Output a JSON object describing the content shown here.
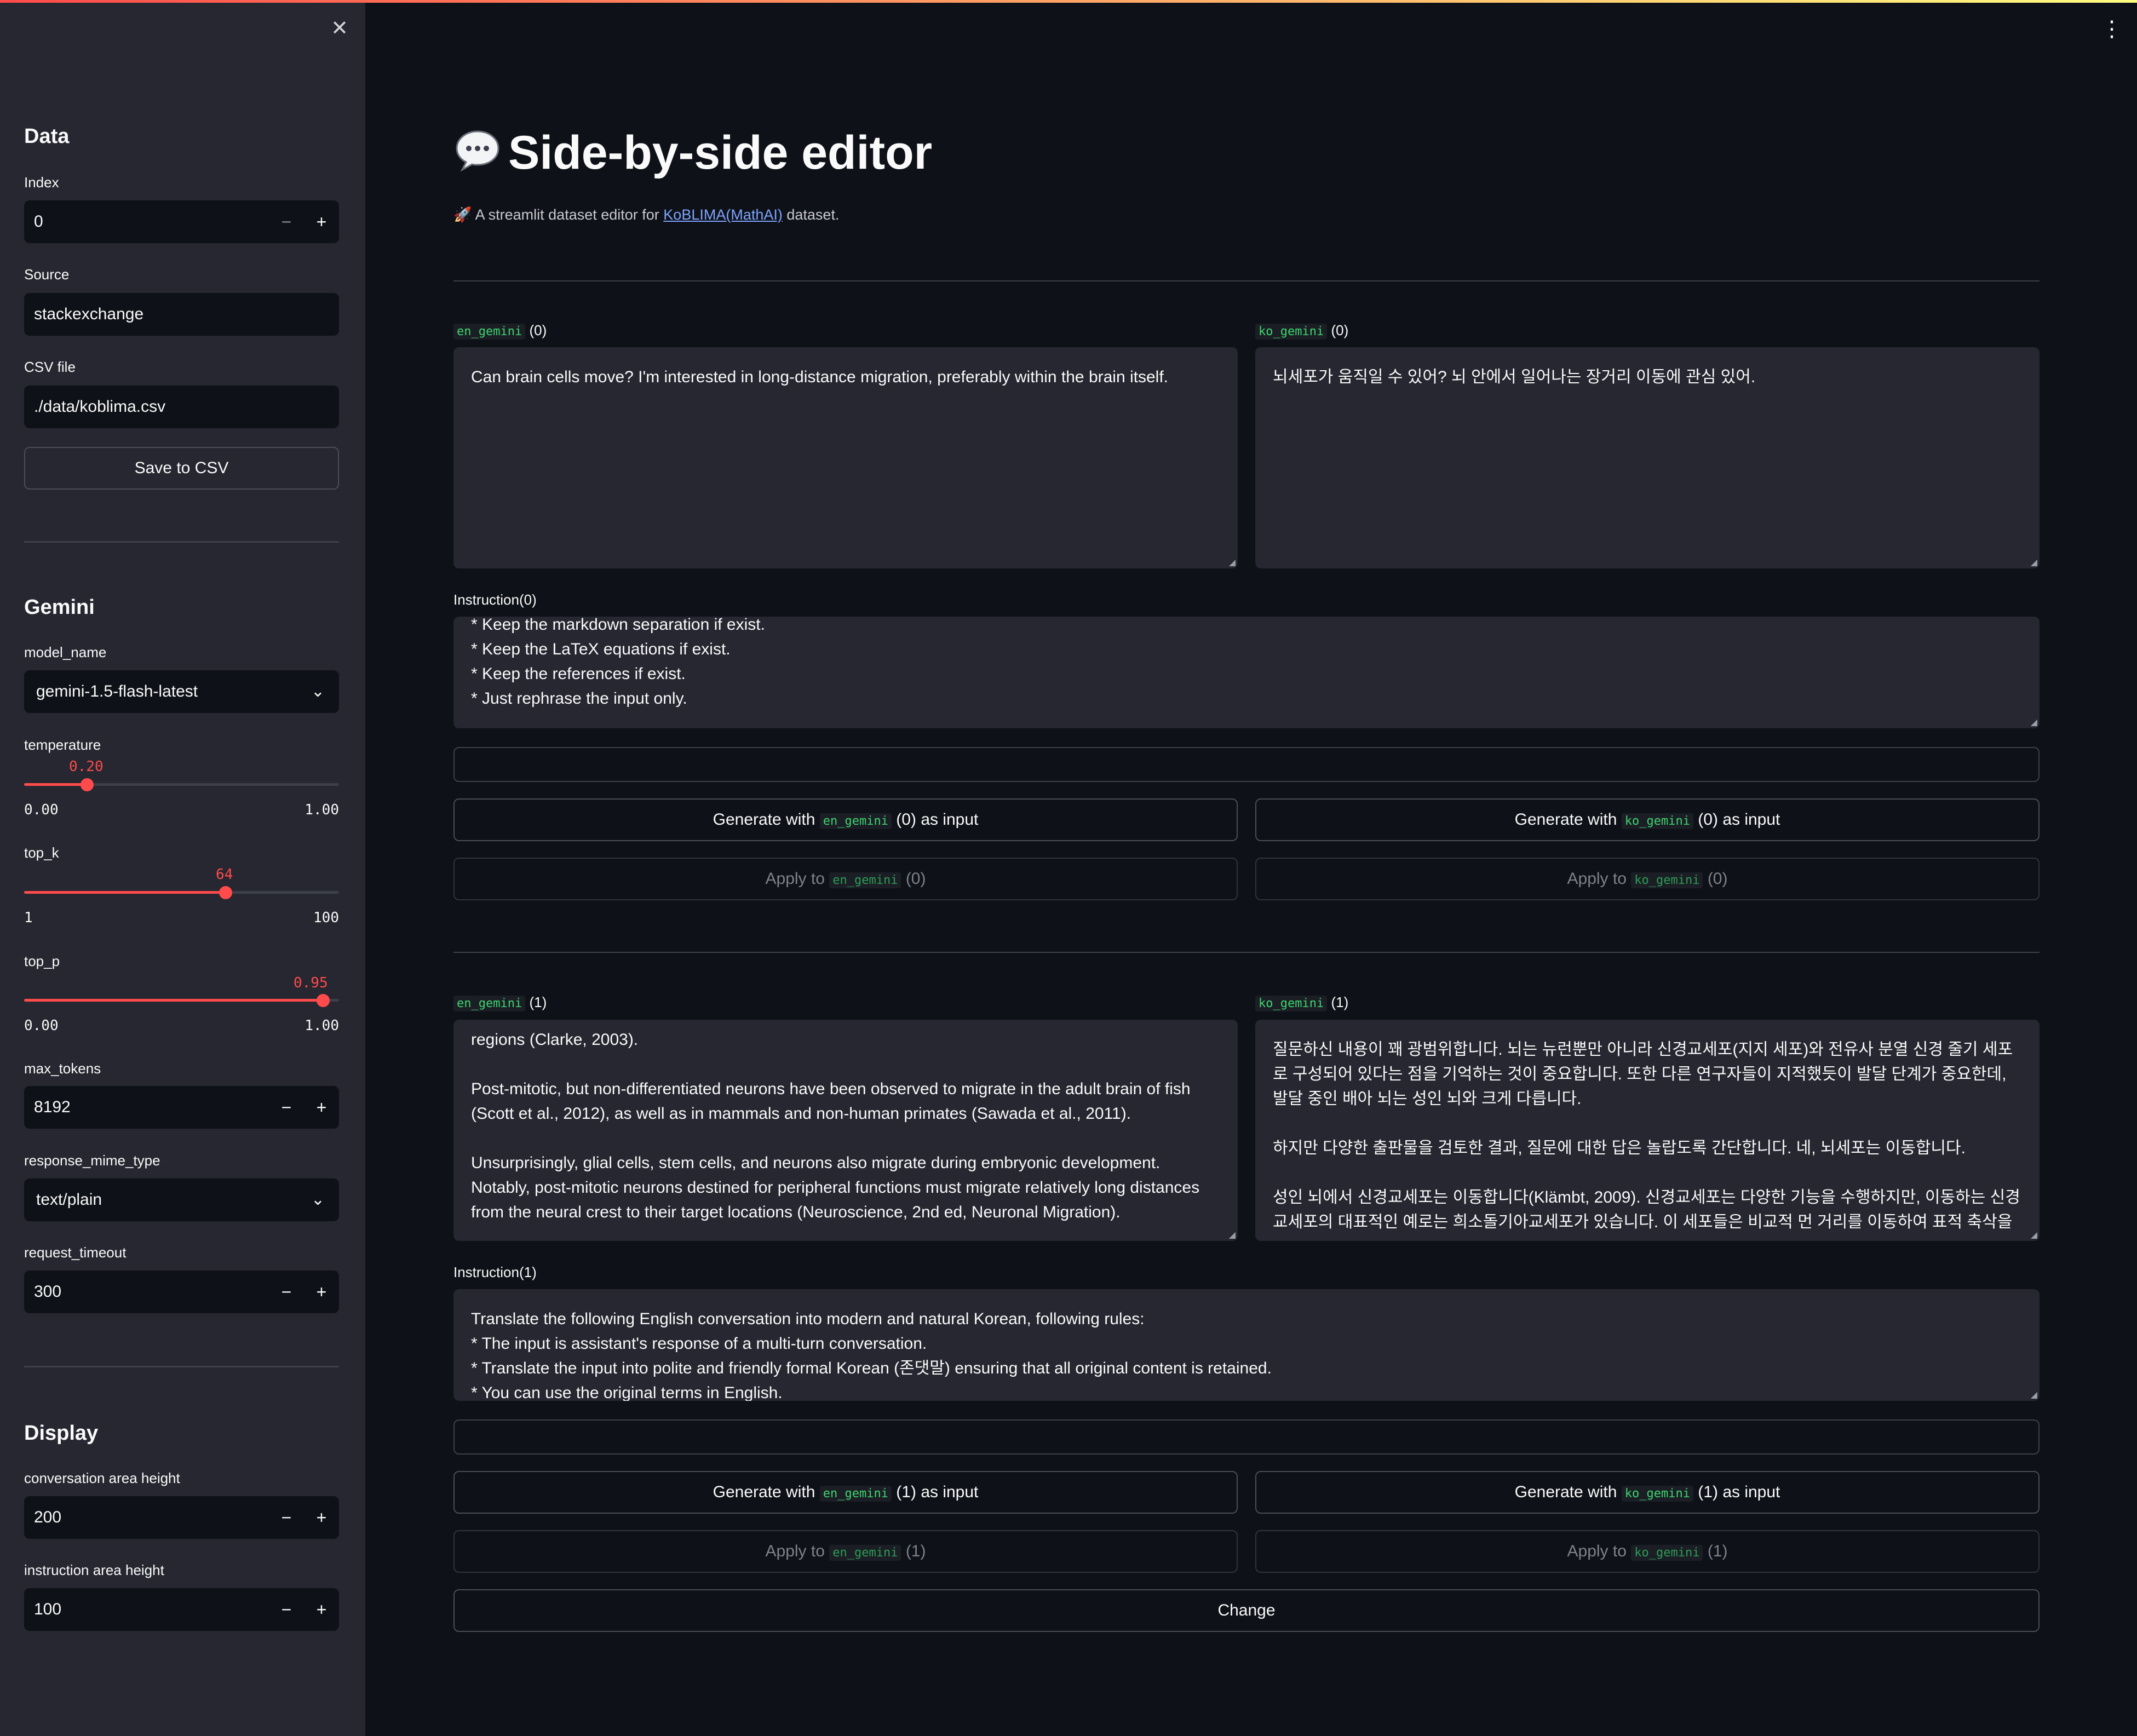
{
  "colors": {
    "accent": "#ff4b4b",
    "background": "#0e1117",
    "sidebar": "#262730",
    "link": "#7da4ff",
    "code": "#3dd56d"
  },
  "sidebar": {
    "close_icon": "close-icon",
    "data": {
      "header": "Data",
      "index_label": "Index",
      "index_value": "0",
      "source_label": "Source",
      "source_value": "stackexchange",
      "csv_label": "CSV file",
      "csv_value": "./data/koblima.csv",
      "save_label": "Save to CSV"
    },
    "gemini": {
      "header": "Gemini",
      "model_name_label": "model_name",
      "model_name_value": "gemini-1.5-flash-latest",
      "temperature": {
        "label": "temperature",
        "value": "0.20",
        "min": "0.00",
        "max": "1.00",
        "fraction": 0.2
      },
      "top_k": {
        "label": "top_k",
        "value": "64",
        "min": "1",
        "max": "100",
        "fraction": 0.64
      },
      "top_p": {
        "label": "top_p",
        "value": "0.95",
        "min": "0.00",
        "max": "1.00",
        "fraction": 0.95
      },
      "max_tokens_label": "max_tokens",
      "max_tokens_value": "8192",
      "mime_label": "response_mime_type",
      "mime_value": "text/plain",
      "timeout_label": "request_timeout",
      "timeout_value": "300"
    },
    "display": {
      "header": "Display",
      "conv_height_label": "conversation area height",
      "conv_height_value": "200",
      "instr_height_label": "instruction area height",
      "instr_height_value": "100"
    },
    "stepper": {
      "minus": "−",
      "plus": "+"
    }
  },
  "main": {
    "title": "Side-by-side editor",
    "subtitle_prefix": "🚀 A streamlit dataset editor for ",
    "subtitle_link": "KoBLIMA(MathAI)",
    "subtitle_suffix": " dataset.",
    "tag_en": "en_gemini",
    "tag_ko": "ko_gemini",
    "generate_prefix": "Generate with",
    "apply_prefix": "Apply to",
    "as_input": "as input",
    "change_label": "Change",
    "turns": [
      {
        "index_label": "(0)",
        "en_text": "Can brain cells move? I'm interested in long-distance migration, preferably within the brain itself.",
        "ko_text": "뇌세포가 움직일 수 있어? 뇌 안에서 일어나는 장거리 이동에 관심 있어.",
        "instruction_label": "Instruction(0)",
        "instruction_text": "* Keep the markdown separation if exist.\n* Keep the LaTeX equations if exist.\n* Keep the references if exist.\n* Just rephrase the input only."
      },
      {
        "index_label": "(1)",
        "en_text": "regions (Clarke, 2003).\n\nPost-mitotic, but non-differentiated neurons have been observed to migrate in the adult brain of fish (Scott et al., 2012), as well as in mammals and non-human primates (Sawada et al., 2011).\n\nUnsurprisingly, glial cells, stem cells, and neurons also migrate during embryonic development. Notably, post-mitotic neurons destined for peripheral functions must migrate relatively long distances from the neural crest to their target locations (Neuroscience, 2nd ed, Neuronal Migration).",
        "ko_text": "질문하신 내용이 꽤 광범위합니다. 뇌는 뉴런뿐만 아니라 신경교세포(지지 세포)와 전유사 분열 신경 줄기 세포로 구성되어 있다는 점을 기억하는 것이 중요합니다. 또한 다른 연구자들이 지적했듯이 발달 단계가 중요한데, 발달 중인 배아 뇌는 성인 뇌와 크게 다릅니다.\n\n하지만 다양한 출판물을 검토한 결과, 질문에 대한 답은 놀랍도록 간단합니다. 네, 뇌세포는 이동합니다.\n\n성인 뇌에서 신경교세포는 이동합니다(Klämbt, 2009). 신경교세포는 다양한 기능을 수행하지만, 이동하는 신경교세포의 대표적인 예로는 희소돌기아교세포가 있습니다. 이 세포들은 비교적 먼 거리를 이동하여 표적 축삭을",
        "instruction_label": "Instruction(1)",
        "instruction_text": "Translate the following English conversation into modern and natural Korean, following rules:\n* The input is assistant's response of a multi-turn conversation.\n* Translate the input into polite and friendly formal Korean (존댓말) ensuring that all original content is retained.\n* You can use the original terms in English."
      }
    ]
  }
}
